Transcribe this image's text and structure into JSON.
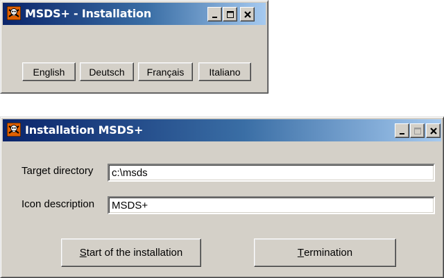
{
  "lang_window": {
    "title": "MSDS+ - Installation",
    "buttons": [
      "English",
      "Deutsch",
      "Français",
      "Italiano"
    ]
  },
  "install_window": {
    "title": "Installation MSDS+",
    "target_label": "Target directory",
    "target_value": "c:\\msds",
    "icon_label": "Icon description",
    "icon_value": "MSDS+",
    "start_button": {
      "first": "S",
      "rest": "tart of the installation"
    },
    "termination_button": {
      "first": "T",
      "rest": "ermination"
    }
  },
  "icons": [
    "skull-crossbones-icon",
    "minimize-icon",
    "maximize-icon",
    "close-icon"
  ],
  "colors": {
    "face": "#d4d0c8",
    "title_start": "#0a246a",
    "title_end": "#a6caf0",
    "icon_bg": "#e06000"
  }
}
